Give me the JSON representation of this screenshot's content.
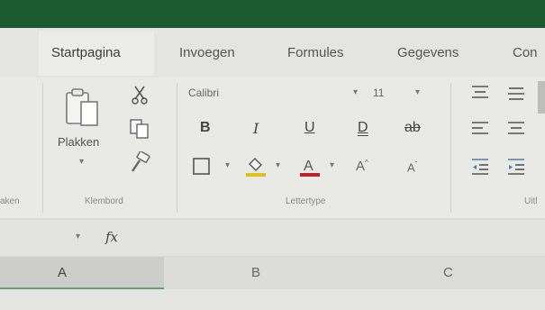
{
  "ribbon": {
    "tabs": [
      "Startpagina",
      "Invoegen",
      "Formules",
      "Gegevens",
      "Con"
    ],
    "groups": {
      "left_partial": "aken",
      "clipboard": "Klembord",
      "font": "Lettertype",
      "alignment_partial": "Uitl"
    },
    "clipboard": {
      "paste_label": "Plakken"
    },
    "font": {
      "name": "Calibri",
      "size": "11"
    }
  },
  "formula_bar": {
    "fx": "fx"
  },
  "columns": [
    "A",
    "B",
    "C"
  ],
  "colors": {
    "title_bar": "#1c5a30",
    "font_color_underline": "#c0202a",
    "highlight_underline": "#e2c21a",
    "selected_column_border": "#6d9b77"
  },
  "icons": [
    "cut-icon",
    "copy-icon",
    "format-painter-icon",
    "paste-icon",
    "borders-icon",
    "fill-color-icon",
    "font-color-icon",
    "align-icons",
    "indent-icons"
  ]
}
